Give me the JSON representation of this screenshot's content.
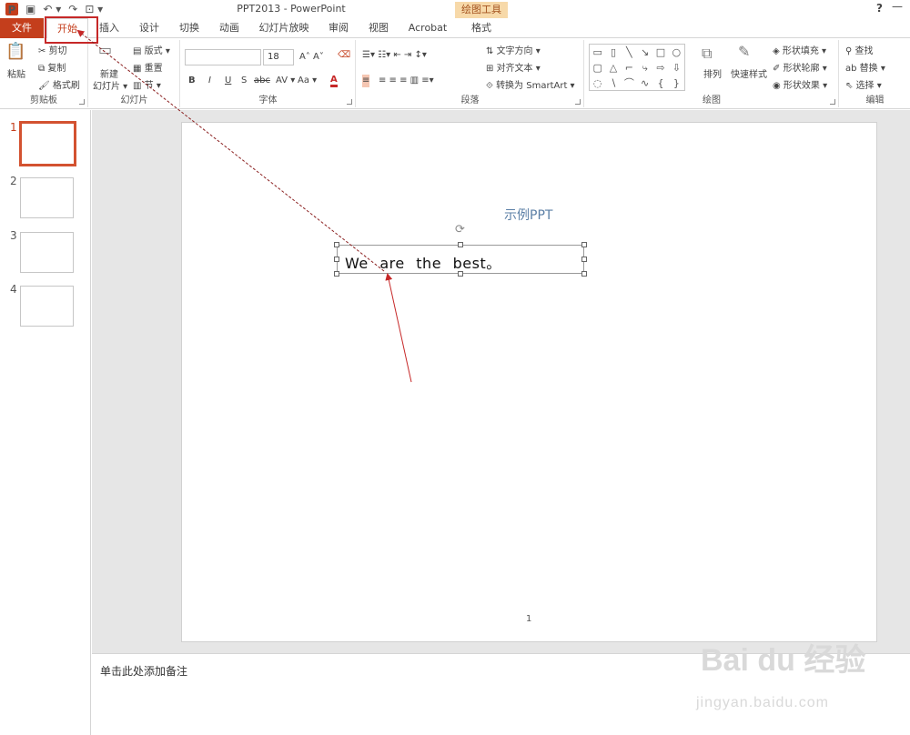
{
  "window": {
    "title": "PPT2013 - PowerPoint",
    "help": "?",
    "minimize": "—"
  },
  "tabs": {
    "file": "文件",
    "home": "开始",
    "insert": "插入",
    "design": "设计",
    "transitions": "切换",
    "animations": "动画",
    "slideshow": "幻灯片放映",
    "review": "审阅",
    "view": "视图",
    "acrobat": "Acrobat",
    "format": "格式",
    "context": "绘图工具"
  },
  "clipboard": {
    "paste": "粘贴",
    "cut": "剪切",
    "copy": "复制",
    "format_painter": "格式刷",
    "label": "剪贴板"
  },
  "slides": {
    "new_slide": "新建",
    "new_slide2": "幻灯片 ▾",
    "layout": "版式 ▾",
    "reset": "重置",
    "section": "节 ▾",
    "label": "幻灯片"
  },
  "font": {
    "name": "",
    "size": "18",
    "bold": "B",
    "italic": "I",
    "underline": "U",
    "strike": "S",
    "abc": "abc",
    "spacing": "AV ▾",
    "case": "Aa ▾",
    "color": "A",
    "label": "字体"
  },
  "paragraph": {
    "text_direction": "文字方向 ▾",
    "align_text": "对齐文本 ▾",
    "smartart": "转换为 SmartArt ▾",
    "label": "段落"
  },
  "drawing": {
    "arrange": "排列",
    "quick_styles": "快速样式",
    "fill": "形状填充 ▾",
    "outline": "形状轮廓 ▾",
    "effects": "形状效果 ▾",
    "label": "绘图"
  },
  "editing": {
    "find": "查找",
    "replace": "替换 ▾",
    "select": "选择 ▾",
    "label": "编辑"
  },
  "thumbnails": [
    "1",
    "2",
    "3",
    "4"
  ],
  "slide": {
    "title": "示例PPT",
    "textbox": "We are the best。",
    "page_number": "1"
  },
  "notes": {
    "placeholder": "单击此处添加备注"
  },
  "watermark": {
    "brand": "Bai du 经验",
    "url": "jingyan.baidu.com"
  },
  "colors": {
    "accent": "#c43e1c",
    "annotation": "#c62828"
  }
}
